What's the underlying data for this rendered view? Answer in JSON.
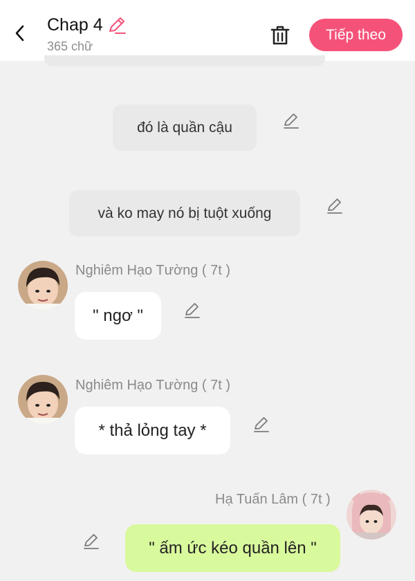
{
  "header": {
    "chapter_title": "Chap 4",
    "word_count": "365 chữ",
    "next_label": "Tiếp theo"
  },
  "colors": {
    "accent": "#f5527a",
    "background": "#f1f1f1",
    "narration_bubble": "#e9e9e9",
    "other_bubble": "#ffffff",
    "self_bubble": "#d9f99d"
  },
  "messages": [
    {
      "type": "narration",
      "text": "đó là quần cậu"
    },
    {
      "type": "narration",
      "text": "và ko may nó bị tuột xuống"
    },
    {
      "type": "left",
      "speaker": "Nghiêm Hạo Tường ( 7t )",
      "text": "\" ngơ \""
    },
    {
      "type": "left",
      "speaker": "Nghiêm Hạo Tường ( 7t )",
      "text": "* thả lỏng tay *"
    },
    {
      "type": "right",
      "speaker": "Hạ Tuấn Lâm ( 7t )",
      "text": "\" ấm ức kéo quần lên \""
    }
  ],
  "icons": {
    "back": "chevron-left-icon",
    "title_edit": "pencil-icon",
    "delete": "trash-icon",
    "message_edit": "pencil-icon",
    "avatar": "avatar"
  }
}
